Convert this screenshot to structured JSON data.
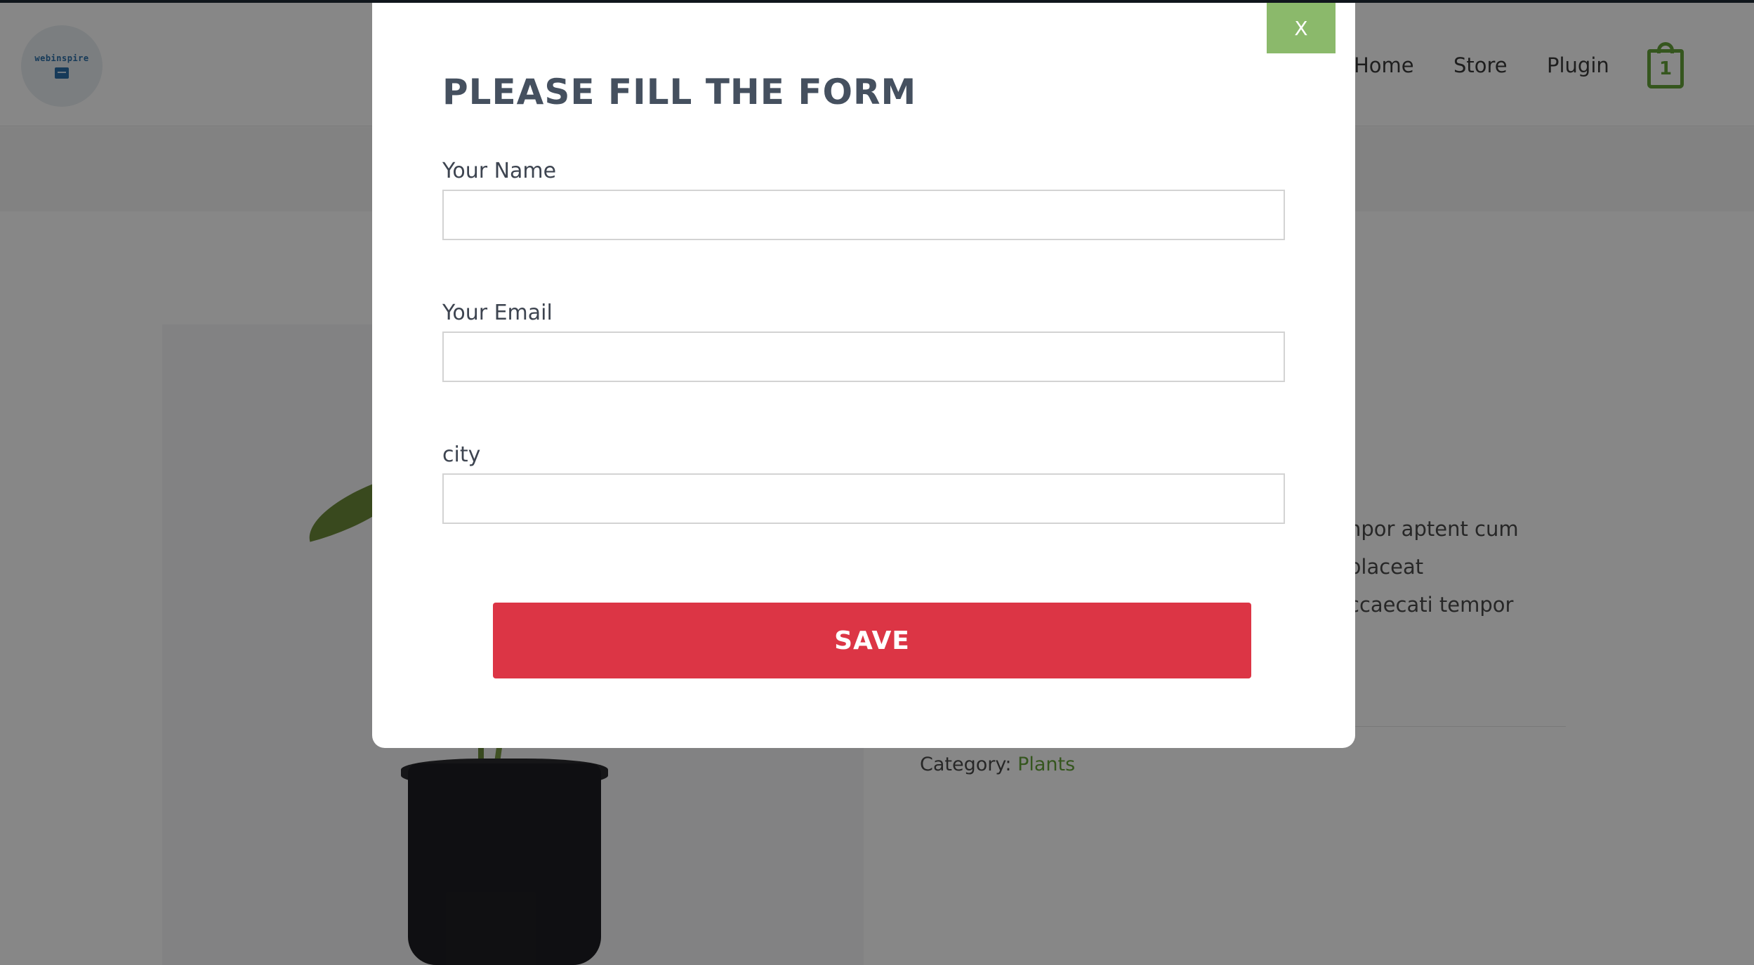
{
  "header": {
    "logo_text": "webinspire",
    "nav": [
      "Home",
      "Store",
      "Plugin"
    ],
    "cart_count": "1"
  },
  "product": {
    "description_lines": [
      "npor aptent cum",
      "placeat",
      "ccaecati tempor"
    ],
    "category_label": "Category:",
    "category_value": "Plants"
  },
  "modal": {
    "close_label": "X",
    "title": "PLEASE FILL THE FORM",
    "fields": [
      {
        "label": "Your Name",
        "value": "",
        "placeholder": ""
      },
      {
        "label": "Your Email",
        "value": "",
        "placeholder": ""
      },
      {
        "label": "city",
        "value": "",
        "placeholder": ""
      }
    ],
    "save_label": "SAVE"
  },
  "colors": {
    "accent_green": "#65a33a",
    "close_green": "#8bb96b",
    "save_red": "#dc3545",
    "overlay": "rgba(0,0,0,0.47)"
  }
}
